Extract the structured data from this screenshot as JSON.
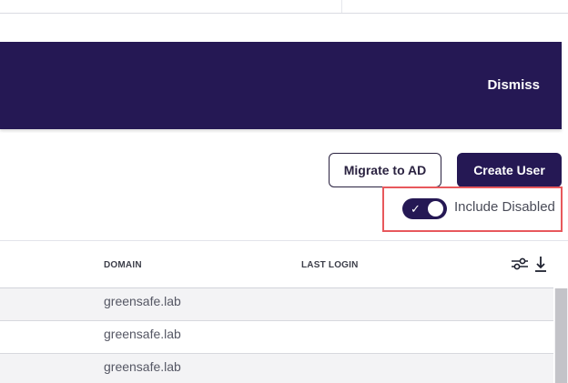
{
  "banner": {
    "dismiss_label": "Dismiss"
  },
  "actions": {
    "migrate_label": "Migrate to AD",
    "create_label": "Create User"
  },
  "filters": {
    "include_disabled_label": "Include Disabled",
    "include_disabled_on": true
  },
  "table": {
    "columns": [
      "DOMAIN",
      "LAST LOGIN"
    ],
    "rows": [
      {
        "domain": "greensafe.lab",
        "last_login": ""
      },
      {
        "domain": "greensafe.lab",
        "last_login": ""
      },
      {
        "domain": "greensafe.lab",
        "last_login": ""
      }
    ]
  },
  "icons": {
    "toggle_check": "check-icon",
    "column_settings": "sliders-icon",
    "download": "download-icon"
  },
  "colors": {
    "brand": "#251854",
    "highlight": "#e8585c"
  }
}
